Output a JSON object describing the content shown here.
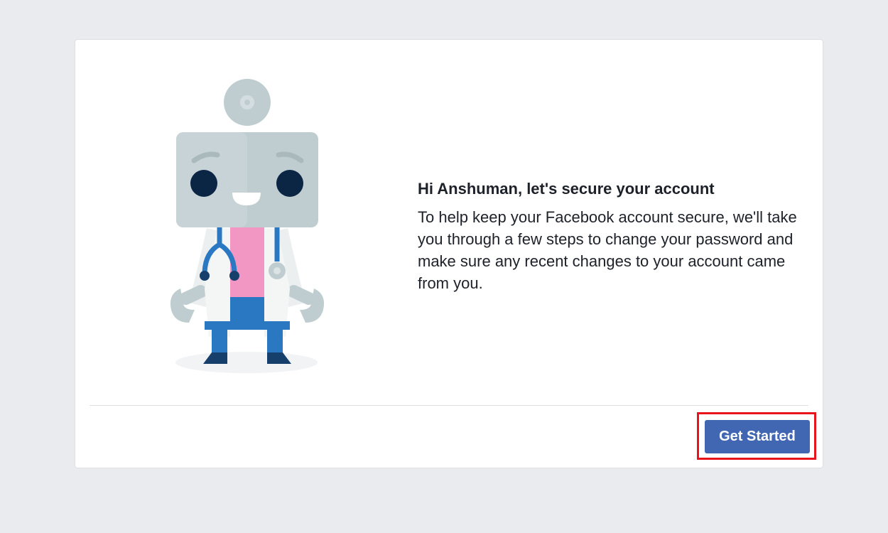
{
  "dialog": {
    "title": "Hi Anshuman, let's secure your account",
    "body": "To help keep your Facebook account secure, we'll take you through a few steps to change your password and make sure any recent changes to your account came from you.",
    "primary_button_label": "Get Started",
    "illustration": "doctor-robot-illustration"
  },
  "colors": {
    "page_background": "#e9ebee",
    "card_background": "#ffffff",
    "primary_button": "#4267b2",
    "highlight_border": "#e8141c",
    "text": "#1d2129"
  }
}
